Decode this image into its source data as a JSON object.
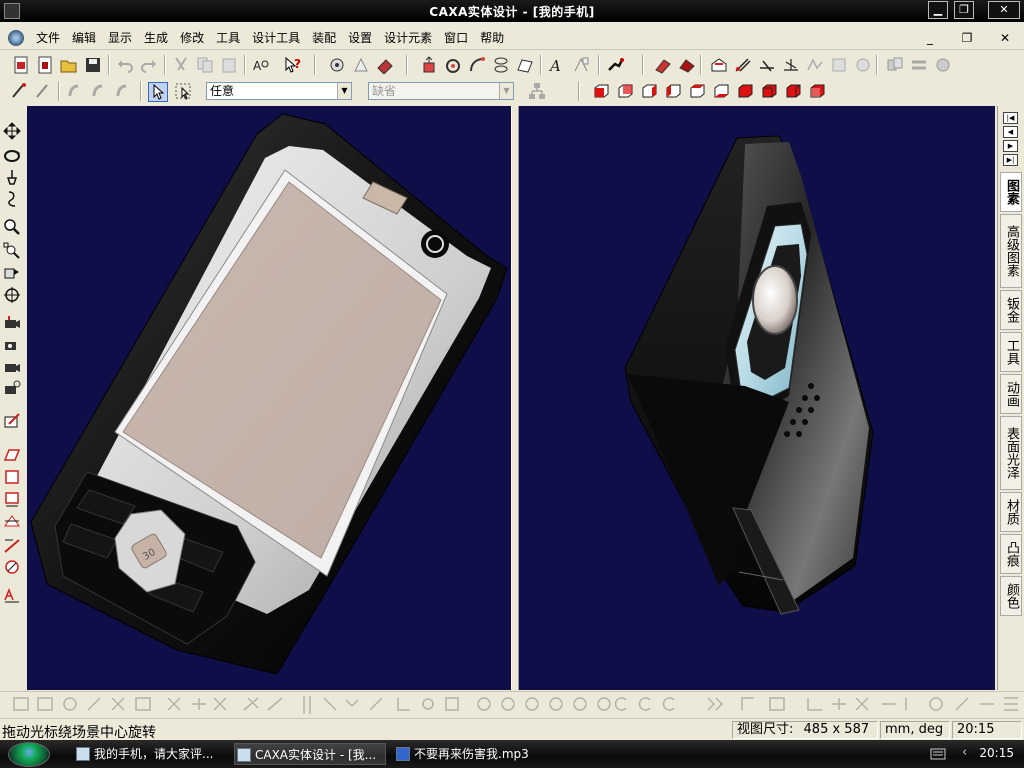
{
  "window": {
    "title": "CAXA实体设计 - [我的手机]"
  },
  "menubar": {
    "items": [
      "文件",
      "编辑",
      "显示",
      "生成",
      "修改",
      "工具",
      "设计工具",
      "装配",
      "设置",
      "设计元素",
      "窗口",
      "帮助"
    ]
  },
  "toolbar2": {
    "filter_value": "任意",
    "default_value": "缺省"
  },
  "right_tabs": [
    "图素",
    "高级图素",
    "钣金",
    "工具",
    "动画",
    "表面光泽",
    "材质",
    "凸痕",
    "颜色"
  ],
  "status": {
    "message": "拖动光标绕场景中心旋转",
    "view_size_label": "视图尺寸:",
    "view_size": "485 x 587",
    "units": "mm, deg",
    "time": "20:15"
  },
  "taskbar": {
    "tasks": [
      "我的手机，请大家评...",
      "CAXA实体设计 - [我...",
      "不要再来伤害我.mp3"
    ],
    "clock": "20:15"
  },
  "colors": {
    "viewport_bg": "#0f0e49",
    "titlebar_bg": "#000000",
    "chrome": "#ece9d8"
  },
  "scene": {
    "left_phone_key_label": "30"
  }
}
